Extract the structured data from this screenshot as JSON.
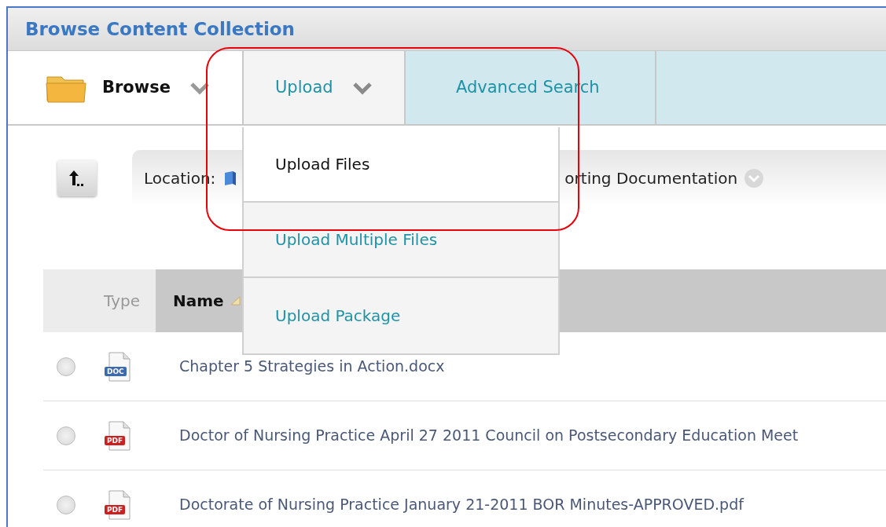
{
  "window": {
    "title": "Browse Content Collection"
  },
  "tabs": [
    {
      "label": "Browse",
      "selected": true,
      "dropdown": true,
      "expanded": false
    },
    {
      "label": "Upload",
      "selected": false,
      "dropdown": true,
      "expanded": true
    },
    {
      "label": "Advanced Search",
      "selected": false,
      "dropdown": false,
      "expanded": false
    }
  ],
  "upload_menu": [
    {
      "label": "Upload Files",
      "highlighted": true
    },
    {
      "label": "Upload Multiple Files",
      "highlighted": false
    },
    {
      "label": "Upload Package",
      "highlighted": false
    }
  ],
  "location": {
    "label": "Location:",
    "path_visible": "orting Documentation"
  },
  "table": {
    "columns": [
      "Type",
      "Name"
    ],
    "rows": [
      {
        "selected": false,
        "file_type": "DOC",
        "name": "Chapter 5 Strategies in Action.docx"
      },
      {
        "selected": false,
        "file_type": "PDF",
        "name": "Doctor of Nursing Practice April 27 2011 Council on Postsecondary Education Meet"
      },
      {
        "selected": false,
        "file_type": "PDF",
        "name": "Doctorate of Nursing Practice January 21-2011 BOR Minutes-APPROVED.pdf"
      }
    ]
  }
}
